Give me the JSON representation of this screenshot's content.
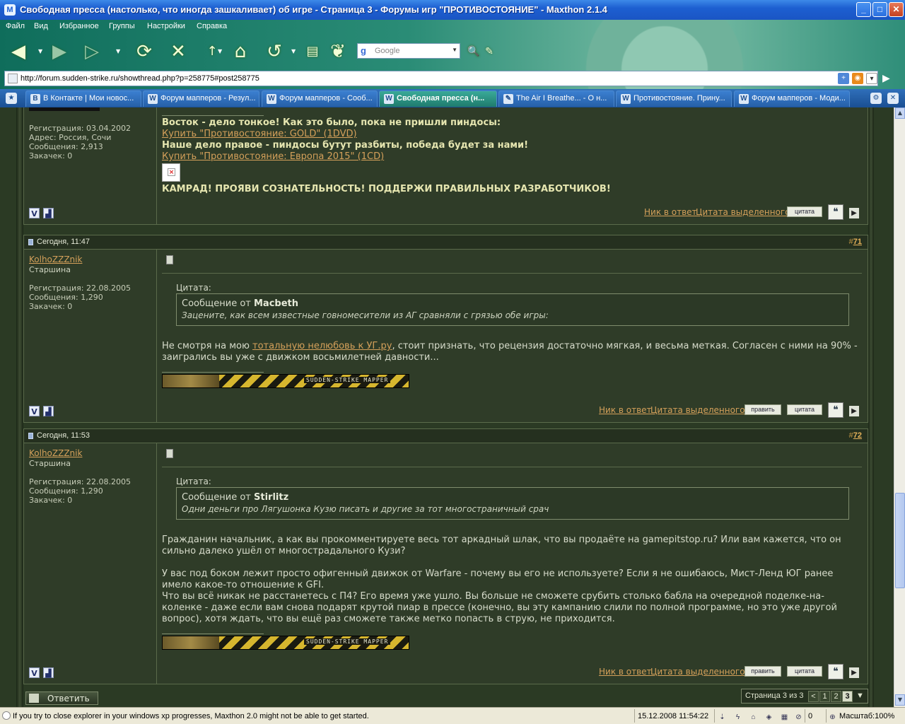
{
  "window": {
    "title": "Свободная пресса (настолько, что иногда зашкаливает) об игре - Страница 3 - Форумы игр \"ПРОТИВОСТОЯНИЕ\" - Maxthon 2.1.4",
    "minimize": "_",
    "maximize": "□",
    "close": "✕"
  },
  "menu": [
    "Файл",
    "Вид",
    "Избранное",
    "Группы",
    "Настройки",
    "Справка"
  ],
  "search": {
    "placeholder": "Google",
    "engine_glyph": "g"
  },
  "address": {
    "url": "http://forum.sudden-strike.ru/showthread.php?p=258775#post258775"
  },
  "tabs": [
    {
      "label": "В Контакте | Мои новос...",
      "icon": "B"
    },
    {
      "label": "Форум мапперов - Резул...",
      "icon": "W"
    },
    {
      "label": "Форум мапперов - Сооб...",
      "icon": "W"
    },
    {
      "label": "Свободная пресса (н...",
      "icon": "W"
    },
    {
      "label": "The Air I Breathe... - О н...",
      "icon": "✎"
    },
    {
      "label": "Противостояние. Прину...",
      "icon": "W"
    },
    {
      "label": "Форум мапперов - Моди...",
      "icon": "W"
    }
  ],
  "post0": {
    "user_info": [
      "Регистрация: 03.04.2002",
      "Адрес: Россия, Сочи",
      "Сообщения: 2,913",
      "Закачек: 0"
    ],
    "line1": "Восток - дело тонкое! Как это было, пока не пришли пиндосы:",
    "link1": "Купить \"Противостояние: GOLD\" (1DVD)",
    "line2": "Наше дело правое - пиндосы бутут разбиты, победа будет за нами!",
    "link2": "Купить \"Противостояние: Европа 2015\" (1CD)",
    "line3": "КАМРАД! ПРОЯВИ СОЗНАТЕЛЬНОСТЬ! ПОДДЕРЖИ ПРАВИЛЬНЫХ РАЗРАБОТЧИКОВ!",
    "broken_img": "×"
  },
  "post71": {
    "date": "Сегодня, 11:47",
    "num_prefix": "#",
    "num": "71",
    "username": "KolhoZZZnik",
    "rank": "Старшина",
    "user_info": [
      "Регистрация: 22.08.2005",
      "Сообщения: 1,290",
      "Закачек: 0"
    ],
    "quote_label": "Цитата:",
    "quote_from_prefix": "Сообщение от",
    "quote_author": "Macbeth",
    "quote_text": "Зацените, как всем известные говномесители из АГ сравняли с грязью обе игры:",
    "text_before": "Не смотря на мою ",
    "text_link": "тотальную нелюбовь к УГ.ру",
    "text_after": ", стоит признать, что рецензия достаточно мягкая, и весьма меткая. Согласен с ними на 90% - заигрались вы уже с движком восьмилетней давности..."
  },
  "post72": {
    "date": "Сегодня, 11:53",
    "num_prefix": "#",
    "num": "72",
    "username": "KolhoZZZnik",
    "rank": "Старшина",
    "user_info": [
      "Регистрация: 22.08.2005",
      "Сообщения: 1,290",
      "Закачек: 0"
    ],
    "quote_label": "Цитата:",
    "quote_from_prefix": "Сообщение от",
    "quote_author": "Stirlitz",
    "quote_text": "Одни деньги про Лягушонка Кузю писать и другие за тот многостраничный срач",
    "para1": "Гражданин начальник, а как вы прокомментируете весь тот аркадный шлак, что вы продаёте на gamepitstop.ru? Или вам кажется, что он сильно далеко ушёл от многострадального Кузи?",
    "para2": "У вас под боком лежит просто офигенный движок от Warfare - почему вы его не используете? Если я не ошибаюсь, Мист-Ленд ЮГ ранее имело какое-то отношение к GFI.",
    "para3": "Что вы всё никак не расстанетесь с П4? Его время уже ушло. Вы больше не сможете срубить столько бабла на очередной поделке-на-коленке - даже если вам снова подарят крутой пиар в прессе (конечно, вы эту кампанию слили по полной программе, но это уже другой вопрос), хотя ждать, что вы ещё раз сможете также метко попасть в струю, не приходится."
  },
  "signature_banner": "SUDDEN-STRIKE MAPPER",
  "actions": {
    "nick_reply": "Ник в ответ",
    "quote_selected": "Цитата выделенного",
    "edit": "править",
    "quote": "цитата"
  },
  "reply_button": "Ответить",
  "pager": {
    "label": "Страница 3 из 3",
    "prev": "<",
    "pages": [
      "1",
      "2",
      "3"
    ],
    "current": "3",
    "menu": "▼"
  },
  "status": {
    "message": "If you try to close explorer in your windows xp progresses, Maxthon 2.0 might not be able to get started.",
    "datetime": "15.12.2008 11:54:22",
    "blocked_count": "0",
    "zoom": "Масштаб:100%"
  }
}
